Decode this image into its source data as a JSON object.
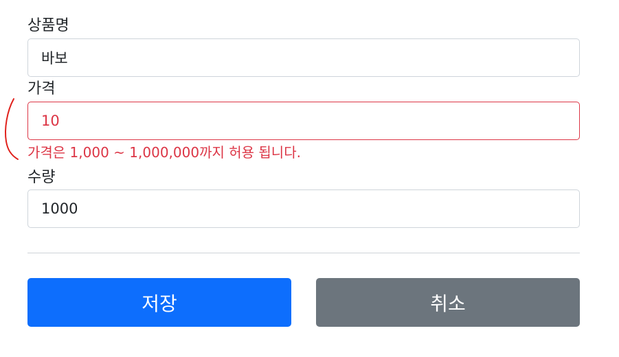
{
  "form": {
    "product_name": {
      "label": "상품명",
      "value": "바보"
    },
    "price": {
      "label": "가격",
      "value": "10",
      "error": "가격은 1,000 ~ 1,000,000까지 허용 됩니다."
    },
    "quantity": {
      "label": "수량",
      "value": "1000"
    }
  },
  "buttons": {
    "save_label": "저장",
    "cancel_label": "취소"
  },
  "colors": {
    "primary": "#0d6efd",
    "secondary": "#6c757d",
    "invalid": "#dc3545",
    "annotation": "#e0201b"
  }
}
